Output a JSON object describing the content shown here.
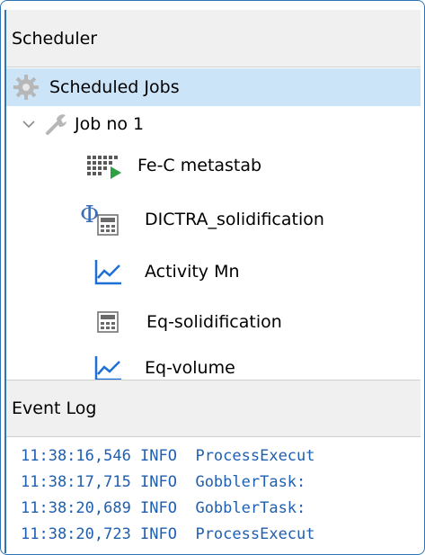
{
  "scheduler": {
    "title": "Scheduler",
    "root_label": "Scheduled Jobs",
    "job_label": "Job no 1",
    "items": [
      {
        "label": "Fe-C metastab",
        "icon": "system-definer-play-icon"
      },
      {
        "label": "DICTRA_solidification",
        "icon": "phi-calculator-icon"
      },
      {
        "label": "Activity Mn",
        "icon": "plot-icon"
      },
      {
        "label": "Eq-solidification",
        "icon": "calculator-icon"
      },
      {
        "label": "Eq-volume",
        "icon": "plot-icon"
      }
    ]
  },
  "event_log": {
    "title": "Event Log",
    "lines": [
      "11:38:16,546 INFO  ProcessExecut",
      "11:38:17,715 INFO  GobblerTask:",
      "11:38:20,689 INFO  GobblerTask:",
      "11:38:20,723 INFO  ProcessExecut"
    ]
  },
  "colors": {
    "frame_border": "#2f75b5",
    "selection": "#cce4f7",
    "log_text": "#1f5fb0",
    "plot_icon": "#1e6fd6",
    "play_green": "#2ea043"
  }
}
